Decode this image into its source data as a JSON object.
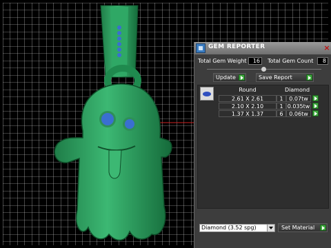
{
  "window": {
    "title": "GEM REPORTER",
    "close_glyph": "×"
  },
  "totals": {
    "weight_label": "Total Gem Weight",
    "weight_value": "16",
    "count_label": "Total Gem Count",
    "count_value": "8"
  },
  "buttons": {
    "update": "Update",
    "save_report": "Save Report",
    "set_material": "Set Material"
  },
  "table": {
    "headers": [
      "Round",
      "Diamond"
    ],
    "rows": [
      {
        "size": "2.61 X 2.61",
        "qty": "1",
        "weight": "0.07tw"
      },
      {
        "size": "2.10 X 2.10",
        "qty": "1",
        "weight": "0.035tw"
      },
      {
        "size": "1.37 X 1.37",
        "qty": "6",
        "weight": "0.06tw"
      }
    ]
  },
  "material_select": {
    "value": "Diamond    (3.52 spg)"
  },
  "colors": {
    "model": "#2e9a5e",
    "gems": "#3a6fd0",
    "grid": "#ffffff"
  }
}
